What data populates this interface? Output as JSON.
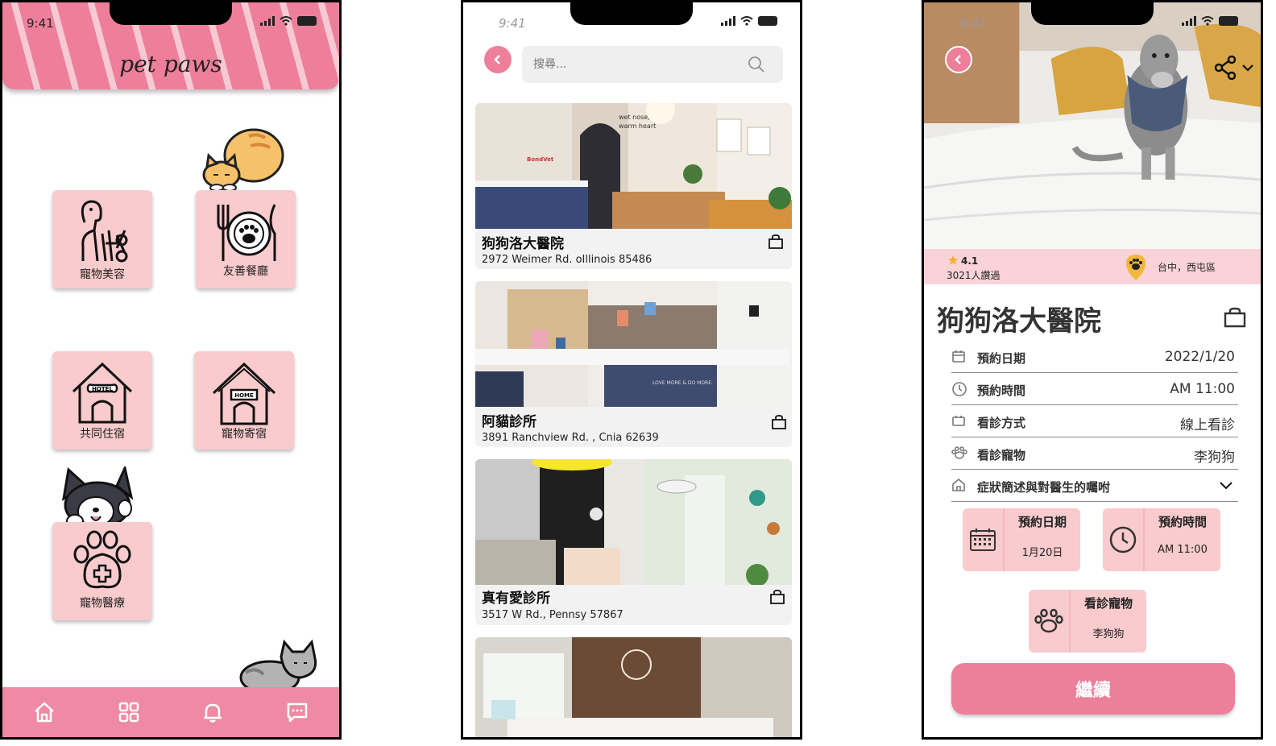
{
  "status_bar": {
    "time": "9:41"
  },
  "home": {
    "brand": "pet paws",
    "tiles": [
      {
        "label": "寵物美容",
        "icon": "dog-grooming-icon"
      },
      {
        "label": "友善餐廳",
        "icon": "pet-restaurant-icon"
      },
      {
        "label": "共同住宿",
        "icon": "hotel-house-icon"
      },
      {
        "label": "寵物寄宿",
        "icon": "home-house-icon"
      },
      {
        "label": "寵物醫療",
        "icon": "paw-medical-icon"
      }
    ],
    "nav": [
      {
        "icon": "home-icon"
      },
      {
        "icon": "grid-icon"
      },
      {
        "icon": "bell-icon"
      },
      {
        "icon": "chat-icon"
      }
    ],
    "colors": {
      "header": "#ee7f9b",
      "tile": "#f9cbcd",
      "nav": "#ee8aa3"
    }
  },
  "list": {
    "search_placeholder": "搜尋...",
    "items": [
      {
        "name": "狗狗洛大醫院",
        "address": "2972 Weimer Rd. oIllinois 85486"
      },
      {
        "name": "阿貓診所",
        "address": "3891 Ranchview Rd. , Cnia 62639"
      },
      {
        "name": "真有愛診所",
        "address": "3517 W Rd., Pennsy 57867"
      },
      {
        "name": "",
        "address": ""
      }
    ]
  },
  "detail": {
    "rating": "4.1",
    "reviews": "3021人讚過",
    "location": "台中，西屯區",
    "title": "狗狗洛大醫院",
    "rows": [
      {
        "key": "預約日期",
        "value": "2022/1/20",
        "icon": "calendar-icon"
      },
      {
        "key": "預約時間",
        "value": "AM 11:00",
        "icon": "clock-icon"
      },
      {
        "key": "看診方式",
        "value": "線上看診",
        "icon": "video-icon"
      },
      {
        "key": "看診寵物",
        "value": "李狗狗",
        "icon": "paw-icon"
      },
      {
        "key": "症狀簡述與對醫生的囑咐",
        "value": "",
        "icon": "building-icon"
      }
    ],
    "summary": [
      {
        "title": "預約日期",
        "value": "1月20日",
        "icon": "calendar-icon"
      },
      {
        "title": "預約時間",
        "value": "AM 11:00",
        "icon": "clock-icon"
      },
      {
        "title": "看診寵物",
        "value": "李狗狗",
        "icon": "paw-icon"
      }
    ],
    "continue_label": "繼續",
    "colors": {
      "accent": "#ec7f9a",
      "band": "#f9d3d8"
    }
  }
}
